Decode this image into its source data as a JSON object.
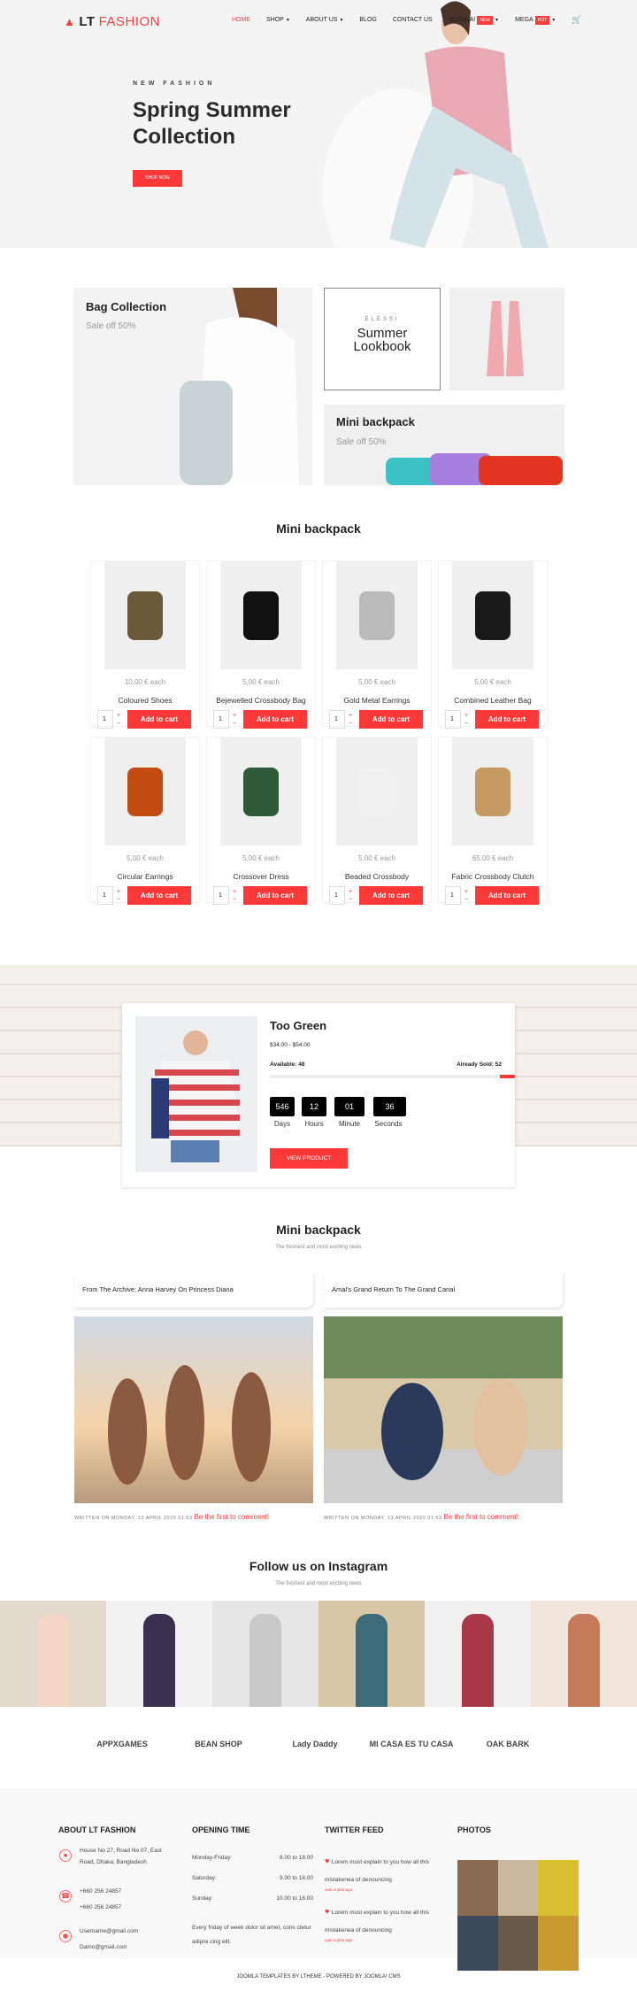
{
  "brand": {
    "prefix": "LT",
    "name": "FASHION"
  },
  "nav": [
    {
      "label": "HOME",
      "active": true
    },
    {
      "label": "SHOP",
      "caret": true
    },
    {
      "label": "ABOUT US",
      "caret": true
    },
    {
      "label": "BLOG"
    },
    {
      "label": "CONTACT US"
    },
    {
      "label": "JOOMLA!",
      "badge": "NEW",
      "caret": true
    },
    {
      "label": "MEGA",
      "badge": "HOT",
      "caret": true
    }
  ],
  "hero": {
    "kicker": "NEW FASHION",
    "title_line1": "Spring Summer",
    "title_line2": "Collection",
    "button": "SHOP NOW"
  },
  "banners": {
    "bag": {
      "title": "Bag Collection",
      "sub": "Sale off 50%"
    },
    "lookbook": {
      "kicker": "ELESSI",
      "line1": "Summer",
      "line2": "Lookbook"
    },
    "mini": {
      "title": "Mini backpack",
      "sub": "Sale off 50%"
    }
  },
  "products_heading": "Mini backpack",
  "products": [
    {
      "price": "10,00 € each",
      "name": "Coloured Shoes",
      "qty": "1",
      "cta": "Add to cart"
    },
    {
      "price": "5,00 € each",
      "name": "Bejewelled Crossbody Bag",
      "qty": "1",
      "cta": "Add to cart"
    },
    {
      "price": "5,00 € each",
      "name": "Gold Metal Earrings",
      "qty": "1",
      "cta": "Add to cart"
    },
    {
      "price": "5,00 € each",
      "name": "Combined Leather Bag",
      "qty": "1",
      "cta": "Add to cart"
    },
    {
      "price": "5,00 € each",
      "name": "Circular Earrings",
      "qty": "1",
      "cta": "Add to cart"
    },
    {
      "price": "5,00 € each",
      "name": "Crossover Dress",
      "qty": "1",
      "cta": "Add to cart"
    },
    {
      "price": "5,00 € each",
      "name": "Beaded Crossbody",
      "qty": "1",
      "cta": "Add to cart"
    },
    {
      "price": "65,00 € each",
      "name": "Fabric Crossbody Clutch",
      "qty": "1",
      "cta": "Add to cart"
    }
  ],
  "deal": {
    "title": "Too Green",
    "price": "$34.00 - $54.00",
    "available": "Available: 48",
    "sold": "Already Sold: 52",
    "sold_fraction": 0.52,
    "countdown": [
      {
        "value": "546",
        "label": "Days"
      },
      {
        "value": "12",
        "label": "Hours"
      },
      {
        "value": "01",
        "label": "Minute"
      },
      {
        "value": "36",
        "label": "Seconds"
      }
    ],
    "button": "VIEW PRODUCT"
  },
  "blog": {
    "heading": "Mini backpack",
    "sub": "The freshest and most exciting news",
    "posts": [
      {
        "title": "From The Archive: Anna Harvey On Princess Diana",
        "meta": "WRITTEN ON MONDAY, 13 APRIL 2020 01:53",
        "comment": "Be the first to comment!"
      },
      {
        "title": "Amal's Grand Return To The Grand Canal",
        "meta": "WRITTEN ON MONDAY, 13 APRIL 2020 01:53",
        "comment": "Be the first to comment!"
      }
    ]
  },
  "instagram": {
    "heading": "Follow us on Instagram",
    "sub": "The freshest and most exciting news"
  },
  "brands": [
    "APPXGAMES",
    "BEAN SHOP",
    "Lady Daddy",
    "MI CASA ES TU CASA",
    "OAK BARK"
  ],
  "footer": {
    "about": {
      "title": "ABOUT LT FASHION",
      "address": [
        "House No 27, Road No 07, East",
        "Road, Dhaka, Bangladesh"
      ],
      "phones": [
        "+660 256 24857",
        "+660 256 24857"
      ],
      "emails": [
        "Username@gmail.com",
        "Damo@gmail.com"
      ]
    },
    "hours": {
      "title": "OPENING TIME",
      "rows": [
        {
          "day": "Monday-Friday:",
          "time": "8.00 to 18.00"
        },
        {
          "day": "Saturday:",
          "time": "9.00 to 18.00"
        },
        {
          "day": "Sunday:",
          "time": "10.00 to 16.00"
        }
      ],
      "note": "Every friday of week dolor sit amet, cons ctetur adipisi cing elit."
    },
    "twitter": {
      "title": "TWITTER FEED",
      "tweets": [
        {
          "text": "Lorem must explain to you how all this mistakenea of denouncing",
          "time": "over a year ago"
        },
        {
          "text": "Lorem must explain to you how all this mistakenea of denouncing",
          "time": "over a year ago"
        }
      ]
    },
    "photos": {
      "title": "PHOTOS"
    },
    "copyright": "JOOMLA TEMPLATES BY LTHEME - POWERED BY JOOMLA! CMS"
  },
  "colors": {
    "accent": "#ff3838"
  }
}
